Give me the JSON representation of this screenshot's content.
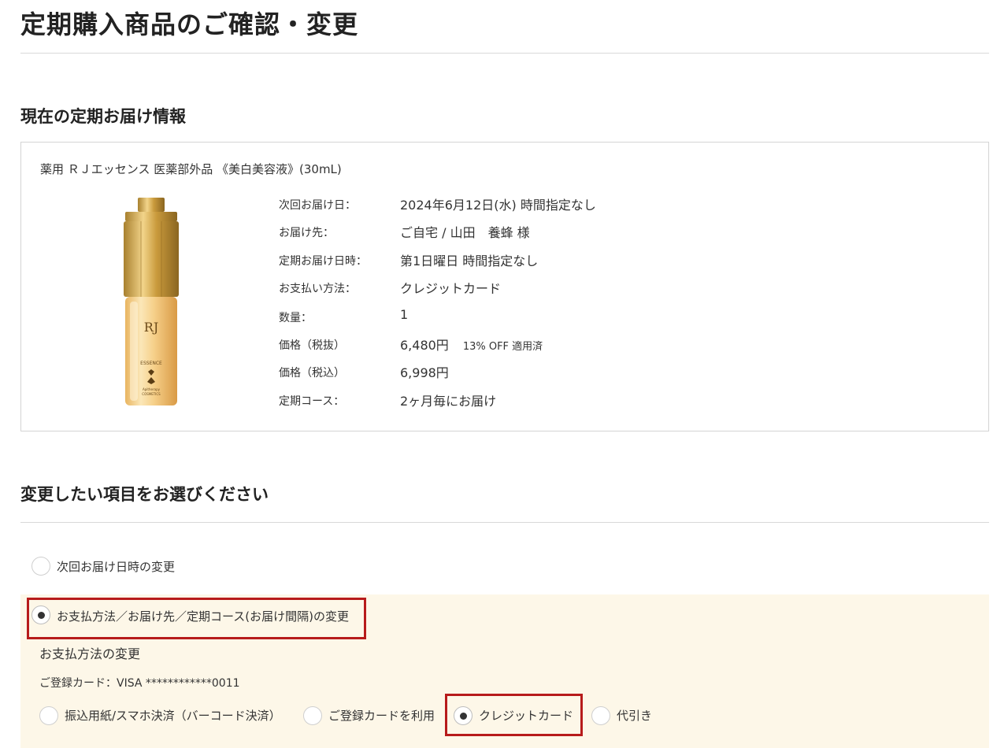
{
  "page": {
    "title": "定期購入商品のご確認・変更"
  },
  "current_delivery": {
    "heading": "現在の定期お届け情報",
    "product_name": "薬用 ＲＪエッセンス 医薬部外品 《美白美容液》(30mL)",
    "image_text": {
      "brand": "RJ",
      "product": "ESSENCE",
      "maker_line1": "Apitherapy",
      "maker_line2": "COSMETICS"
    },
    "details": [
      {
        "label": "次回お届け日：",
        "value": "2024年6月12日(水)  時間指定なし",
        "note": ""
      },
      {
        "label": "お届け先：",
        "value": "ご自宅 /  山田　養蜂 様",
        "note": ""
      },
      {
        "label": "定期お届け日時：",
        "value": "第1日曜日  時間指定なし",
        "note": ""
      },
      {
        "label": "お支払い方法：",
        "value": "クレジットカード",
        "note": ""
      },
      {
        "label": "数量：",
        "value": "1",
        "note": ""
      },
      {
        "label": "価格（税抜）",
        "value": "6,480円",
        "note": "13% OFF 適用済"
      },
      {
        "label": "価格（税込）",
        "value": "6,998円",
        "note": ""
      },
      {
        "label": "定期コース：",
        "value": "2ヶ月毎にお届け",
        "note": ""
      }
    ]
  },
  "change_section": {
    "heading": "変更したい項目をお選びください",
    "options": [
      {
        "label": "次回お届け日時の変更",
        "checked": false
      },
      {
        "label": "お支払方法／お届け先／定期コース(お届け間隔)の変更",
        "checked": true
      }
    ],
    "payment": {
      "subheading": "お支払方法の変更",
      "registered_card": "ご登録カード：VISA  ************0011",
      "methods": [
        {
          "label": "振込用紙/スマホ決済（バーコード決済）",
          "checked": false
        },
        {
          "label": "ご登録カードを利用",
          "checked": false
        },
        {
          "label": "クレジットカード",
          "checked": true
        },
        {
          "label": "代引き",
          "checked": false
        }
      ]
    }
  },
  "colors": {
    "highlight_border": "#b71b1b",
    "panel_background": "#fdf7e8",
    "bottle_gold": "#d4a84a"
  }
}
